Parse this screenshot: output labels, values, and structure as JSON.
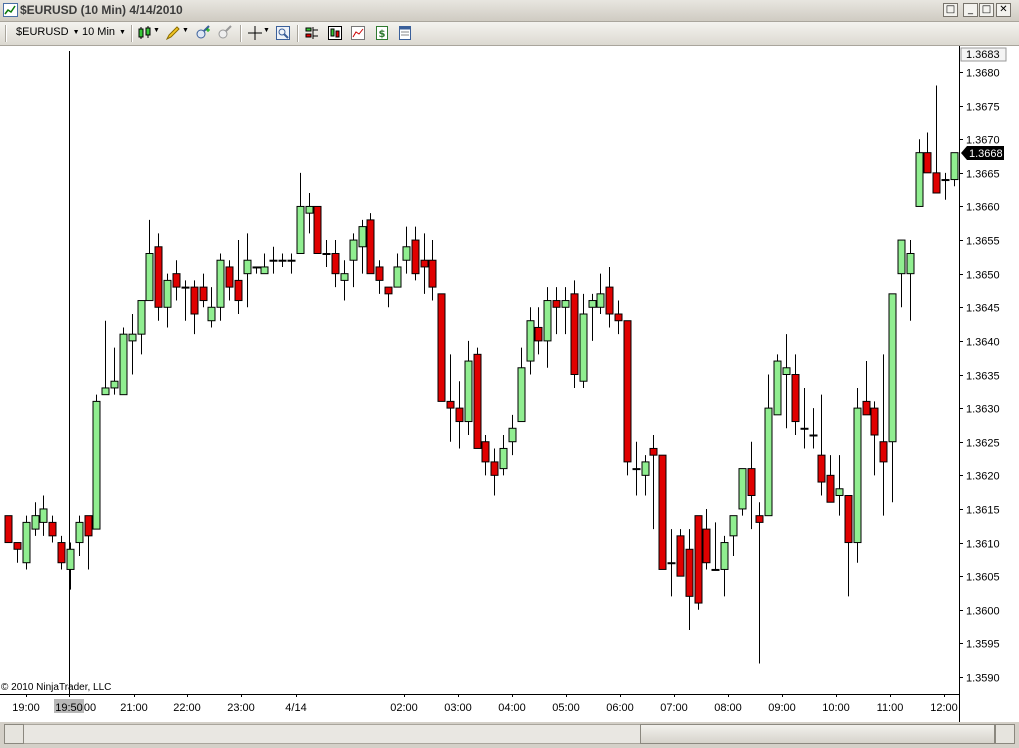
{
  "window": {
    "title": "$EURUSD (10 Min)  4/14/2010",
    "minimize_glyph": "_",
    "restore_glyph": "□",
    "close_glyph": "✕",
    "help_glyph": "□"
  },
  "toolbar": {
    "instrument": "$EURUSD",
    "interval": "10 Min",
    "dropdown_arrow": "▼"
  },
  "copyright": "© 2010 NinjaTrader, LLC",
  "colors": {
    "up": "#90ee90",
    "down": "#e00000",
    "wick": "#000000",
    "axis_text": "#000000",
    "price_marker_bg": "#000000",
    "price_marker_text": "#ffffff"
  },
  "chart_data": {
    "type": "candlestick",
    "ylim": [
      1.3587,
      1.3688
    ],
    "y_ticks": [
      "1.3590",
      "1.3595",
      "1.3600",
      "1.3605",
      "1.3610",
      "1.3615",
      "1.3620",
      "1.3625",
      "1.3630",
      "1.3635",
      "1.3640",
      "1.3645",
      "1.3650",
      "1.3655",
      "1.3660",
      "1.3665",
      "1.3670",
      "1.3675",
      "1.3680"
    ],
    "top_price_label": "1.3683",
    "last_price_label": "1.3668",
    "last_price": 1.3668,
    "x_labels": [
      "19:00",
      "19:50",
      "00",
      "21:00",
      "22:00",
      "23:00",
      "4/14",
      "02:00",
      "03:00",
      "04:00",
      "05:00",
      "06:00",
      "07:00",
      "08:00",
      "09:00",
      "10:00",
      "11:00",
      "12:00"
    ],
    "crosshair_label": "19:50",
    "candles": [
      [
        1.3614,
        1.3614,
        1.361,
        1.361
      ],
      [
        1.361,
        1.361,
        1.3607,
        1.3609
      ],
      [
        1.3607,
        1.3614,
        1.3606,
        1.3613
      ],
      [
        1.3612,
        1.3616,
        1.3611,
        1.3614
      ],
      [
        1.3613,
        1.3617,
        1.3611,
        1.3615
      ],
      [
        1.3613,
        1.3614,
        1.361,
        1.3611
      ],
      [
        1.361,
        1.3611,
        1.3606,
        1.3607
      ],
      [
        1.3606,
        1.361,
        1.3603,
        1.3609
      ],
      [
        1.361,
        1.3614,
        1.3608,
        1.3613
      ],
      [
        1.3614,
        1.3614,
        1.3606,
        1.3611
      ],
      [
        1.3612,
        1.3632,
        1.3612,
        1.3631
      ],
      [
        1.3632,
        1.3643,
        1.3632,
        1.3633
      ],
      [
        1.3633,
        1.3639,
        1.3632,
        1.3634
      ],
      [
        1.3632,
        1.3642,
        1.3632,
        1.3641
      ],
      [
        1.364,
        1.3644,
        1.3635,
        1.3641
      ],
      [
        1.3641,
        1.3646,
        1.3638,
        1.3646
      ],
      [
        1.3646,
        1.3658,
        1.3646,
        1.3653
      ],
      [
        1.3654,
        1.3656,
        1.3643,
        1.3645
      ],
      [
        1.3645,
        1.365,
        1.3642,
        1.3649
      ],
      [
        1.365,
        1.3652,
        1.3646,
        1.3648
      ],
      [
        1.3648,
        1.3649,
        1.3643,
        1.3648
      ],
      [
        1.3648,
        1.3649,
        1.3641,
        1.3644
      ],
      [
        1.3648,
        1.365,
        1.3645,
        1.3646
      ],
      [
        1.3643,
        1.3648,
        1.3642,
        1.3645
      ],
      [
        1.3645,
        1.3653,
        1.3643,
        1.3652
      ],
      [
        1.3651,
        1.3652,
        1.3646,
        1.3648
      ],
      [
        1.3649,
        1.3655,
        1.3644,
        1.3646
      ],
      [
        1.365,
        1.3656,
        1.3645,
        1.3652
      ],
      [
        1.3651,
        1.3651,
        1.365,
        1.3651
      ],
      [
        1.365,
        1.3653,
        1.365,
        1.3651
      ],
      [
        1.3652,
        1.3654,
        1.365,
        1.3652
      ],
      [
        1.3652,
        1.3653,
        1.3651,
        1.3652
      ],
      [
        1.3652,
        1.3653,
        1.365,
        1.3652
      ],
      [
        1.3653,
        1.3665,
        1.3653,
        1.366
      ],
      [
        1.3659,
        1.3662,
        1.3656,
        1.366
      ],
      [
        1.366,
        1.3659,
        1.3653,
        1.3653
      ],
      [
        1.3653,
        1.3655,
        1.3651,
        1.3653
      ],
      [
        1.3653,
        1.3655,
        1.3648,
        1.365
      ],
      [
        1.3649,
        1.3652,
        1.3646,
        1.365
      ],
      [
        1.3652,
        1.3656,
        1.3648,
        1.3655
      ],
      [
        1.3654,
        1.3658,
        1.365,
        1.3657
      ],
      [
        1.3658,
        1.3659,
        1.365,
        1.365
      ],
      [
        1.3651,
        1.3652,
        1.3647,
        1.3649
      ],
      [
        1.3648,
        1.3648,
        1.3645,
        1.3647
      ],
      [
        1.3648,
        1.3653,
        1.3648,
        1.3651
      ],
      [
        1.3652,
        1.3657,
        1.365,
        1.3654
      ],
      [
        1.3655,
        1.3657,
        1.3649,
        1.365
      ],
      [
        1.3652,
        1.3656,
        1.3647,
        1.3651
      ],
      [
        1.3652,
        1.3655,
        1.3646,
        1.3648
      ],
      [
        1.3647,
        1.3647,
        1.3631,
        1.3631
      ],
      [
        1.3631,
        1.3638,
        1.3625,
        1.363
      ],
      [
        1.363,
        1.3634,
        1.3624,
        1.3628
      ],
      [
        1.3628,
        1.364,
        1.3626,
        1.3637
      ],
      [
        1.3638,
        1.3639,
        1.3624,
        1.3624
      ],
      [
        1.3625,
        1.3626,
        1.362,
        1.3622
      ],
      [
        1.3622,
        1.3624,
        1.3617,
        1.362
      ],
      [
        1.3621,
        1.3626,
        1.362,
        1.3624
      ],
      [
        1.3625,
        1.3629,
        1.3623,
        1.3627
      ],
      [
        1.3628,
        1.3639,
        1.3628,
        1.3636
      ],
      [
        1.3637,
        1.3645,
        1.3635,
        1.3643
      ],
      [
        1.3642,
        1.3645,
        1.3638,
        1.364
      ],
      [
        1.364,
        1.3648,
        1.3636,
        1.3646
      ],
      [
        1.3646,
        1.3648,
        1.3641,
        1.3645
      ],
      [
        1.3645,
        1.3648,
        1.3641,
        1.3646
      ],
      [
        1.3647,
        1.3649,
        1.3633,
        1.3635
      ],
      [
        1.3634,
        1.3647,
        1.3633,
        1.3644
      ],
      [
        1.3645,
        1.3647,
        1.364,
        1.3646
      ],
      [
        1.3645,
        1.365,
        1.3644,
        1.3647
      ],
      [
        1.3648,
        1.3651,
        1.3642,
        1.3644
      ],
      [
        1.3644,
        1.3646,
        1.3641,
        1.3643
      ],
      [
        1.3643,
        1.3643,
        1.362,
        1.3622
      ],
      [
        1.3621,
        1.3625,
        1.3617,
        1.3621
      ],
      [
        1.362,
        1.3623,
        1.3617,
        1.3622
      ],
      [
        1.3624,
        1.3626,
        1.3612,
        1.3623
      ],
      [
        1.3623,
        1.3623,
        1.3607,
        1.3606
      ],
      [
        1.3607,
        1.3612,
        1.3602,
        1.3607
      ],
      [
        1.3611,
        1.3612,
        1.3605,
        1.3605
      ],
      [
        1.3609,
        1.3612,
        1.3597,
        1.3602
      ],
      [
        1.3614,
        1.3614,
        1.36,
        1.3601
      ],
      [
        1.3612,
        1.3615,
        1.3606,
        1.3607
      ],
      [
        1.3606,
        1.3613,
        1.3606,
        1.3606
      ],
      [
        1.3606,
        1.3611,
        1.3602,
        1.361
      ],
      [
        1.3611,
        1.3613,
        1.3608,
        1.3614
      ],
      [
        1.3615,
        1.3621,
        1.3614,
        1.3621
      ],
      [
        1.3621,
        1.3625,
        1.3612,
        1.3617
      ],
      [
        1.3614,
        1.3616,
        1.3592,
        1.3613
      ],
      [
        1.3614,
        1.3635,
        1.3614,
        1.363
      ],
      [
        1.3629,
        1.3638,
        1.3629,
        1.3637
      ],
      [
        1.3635,
        1.3641,
        1.3627,
        1.3636
      ],
      [
        1.3635,
        1.3638,
        1.3626,
        1.3628
      ],
      [
        1.3627,
        1.3633,
        1.3624,
        1.3627
      ],
      [
        1.3626,
        1.363,
        1.3624,
        1.3626
      ],
      [
        1.3623,
        1.3632,
        1.3617,
        1.3619
      ],
      [
        1.362,
        1.3623,
        1.3618,
        1.3616
      ],
      [
        1.3617,
        1.3623,
        1.3614,
        1.3618
      ],
      [
        1.3617,
        1.3615,
        1.3602,
        1.361
      ],
      [
        1.361,
        1.3633,
        1.3607,
        1.363
      ],
      [
        1.3631,
        1.3637,
        1.363,
        1.3629
      ],
      [
        1.363,
        1.3631,
        1.362,
        1.3626
      ],
      [
        1.3625,
        1.3638,
        1.3614,
        1.3622
      ],
      [
        1.3625,
        1.3647,
        1.3616,
        1.3647
      ],
      [
        1.365,
        1.3653,
        1.3645,
        1.3655
      ],
      [
        1.365,
        1.3655,
        1.3643,
        1.3653
      ],
      [
        1.366,
        1.367,
        1.366,
        1.3668
      ],
      [
        1.3668,
        1.3671,
        1.3665,
        1.3665
      ],
      [
        1.3665,
        1.3678,
        1.3664,
        1.3662
      ],
      [
        1.3664,
        1.3665,
        1.3661,
        1.3664
      ],
      [
        1.3664,
        1.3668,
        1.3663,
        1.3668
      ]
    ]
  }
}
